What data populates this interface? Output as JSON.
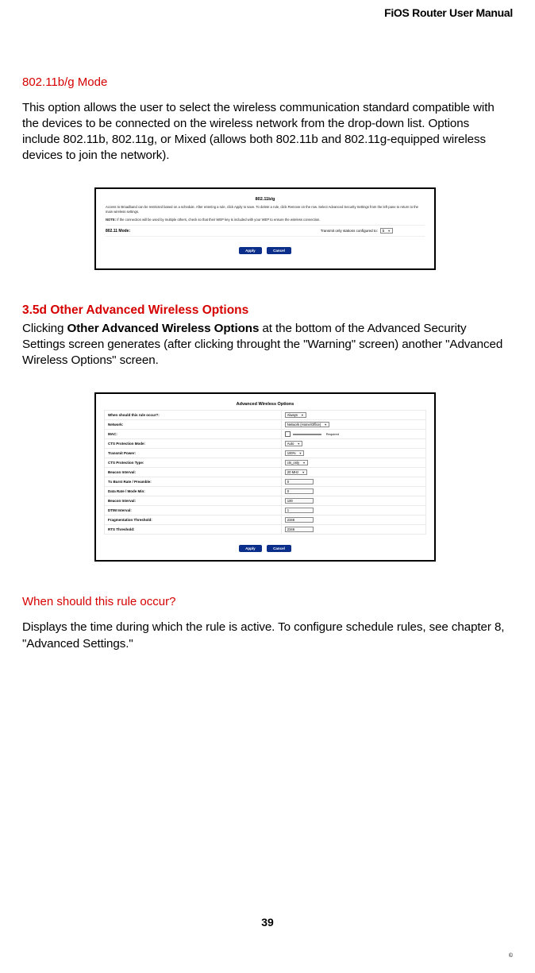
{
  "header": {
    "title": "FiOS Router User Manual"
  },
  "s1": {
    "heading": "802.11b/g Mode",
    "body": "This option allows the user to select the wireless communication standard compatible with the devices to be connected on the wireless network from the drop-down list. Options include 802.11b, 802.11g, or Mixed (allows both 802.11b and 802.11g-equipped wireless devices to join the network)."
  },
  "shot1": {
    "title": "802.11b/g",
    "desc1": "Access to Broadband can be restricted based on a schedule. After entering a rule, click Apply to save. To delete a rule, click Remove on the row. Select Advanced Security Settings from the left pane to return to the main wireless settings.",
    "note_label": "NOTE:",
    "note_text": "If the connection will be used by multiple others, check so that their WEP key is included with your WEP to ensure the wireless connection.",
    "row_label": "802.11 Mode:",
    "row_hint": "Transmit only stations configured to:",
    "select_value": "b",
    "btn_apply": "Apply",
    "btn_cancel": "Cancel"
  },
  "s2": {
    "heading": "3.5d  Other Advanced Wireless Options",
    "body_pre": "Clicking ",
    "body_strong": "Other Advanced Wireless Options",
    "body_post": " at the bottom of the Advanced Security Settings screen generates (after clicking throught the \"Warning\" screen) another \"Advanced Wireless Options\" screen."
  },
  "shot2": {
    "title": "Advanced Wireless Options",
    "rows": [
      {
        "label": "When should this rule occur?:",
        "ctrl": "select",
        "value": "Always"
      },
      {
        "label": "Network:",
        "ctrl": "select",
        "value": "Network (Home/Office)"
      },
      {
        "label": "MAC:",
        "ctrl": "text-dual",
        "value": "",
        "note": "Required"
      },
      {
        "label": "CTS Protection Mode:",
        "ctrl": "select",
        "value": "Auto"
      },
      {
        "label": "Transmit Power:",
        "ctrl": "select",
        "value": "100%"
      },
      {
        "label": "CTS Protection Type:",
        "ctrl": "select",
        "value": "cts_only"
      },
      {
        "label": "Beacon Interval:",
        "ctrl": "select",
        "value": "20 MHz"
      },
      {
        "label": "Tx Burst Rate / Preamble:",
        "ctrl": "text",
        "value": "0"
      },
      {
        "label": "Data Rate / Mode Min:",
        "ctrl": "text",
        "value": "0"
      },
      {
        "label": "Beacon Interval:",
        "ctrl": "text",
        "value": "100"
      },
      {
        "label": "DTIM Interval:",
        "ctrl": "text",
        "value": "1"
      },
      {
        "label": "Fragmentation Threshold:",
        "ctrl": "text",
        "value": "2346"
      },
      {
        "label": "RTS Threshold:",
        "ctrl": "text",
        "value": "2346"
      }
    ],
    "btn_apply": "Apply",
    "btn_cancel": "Cancel"
  },
  "s3": {
    "heading": "When should this rule occur?",
    "body": "Displays the time during which the rule is active. To configure schedule rules, see chapter 8, \"Advanced Settings.\""
  },
  "footer": {
    "page": "39",
    "copyright": "©"
  }
}
